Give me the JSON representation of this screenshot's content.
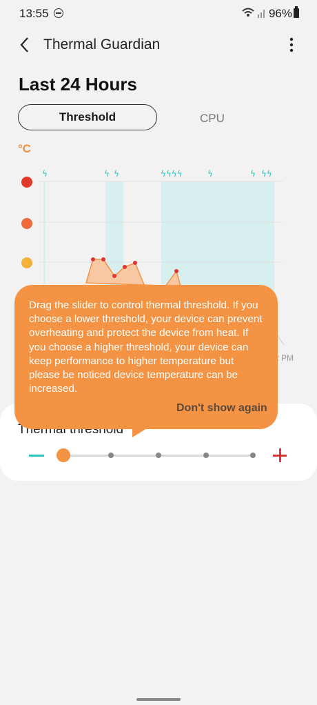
{
  "status_bar": {
    "time": "13:55",
    "battery": "96%"
  },
  "app_bar": {
    "title": "Thermal Guardian"
  },
  "heading": "Last 24 Hours",
  "tabs": {
    "threshold": "Threshold",
    "cpu": "CPU"
  },
  "chart": {
    "unit": "°C",
    "x_tick_fragment": "2 PM"
  },
  "slider": {
    "label": "Thermal threshold",
    "value_fraction": 0.0,
    "steps": 5
  },
  "tooltip": {
    "text": "Drag the slider to control thermal threshold. If you choose a lower threshold, your device can prevent overheating and protect the device from heat. If you choose a higher threshold, your device can keep performance to higher temperature but please be noticed device temperature can be increased.",
    "dont_show": "Don't show again"
  },
  "colors": {
    "accent": "#f49343",
    "teal": "#2bc3c0",
    "red": "#e03535"
  }
}
